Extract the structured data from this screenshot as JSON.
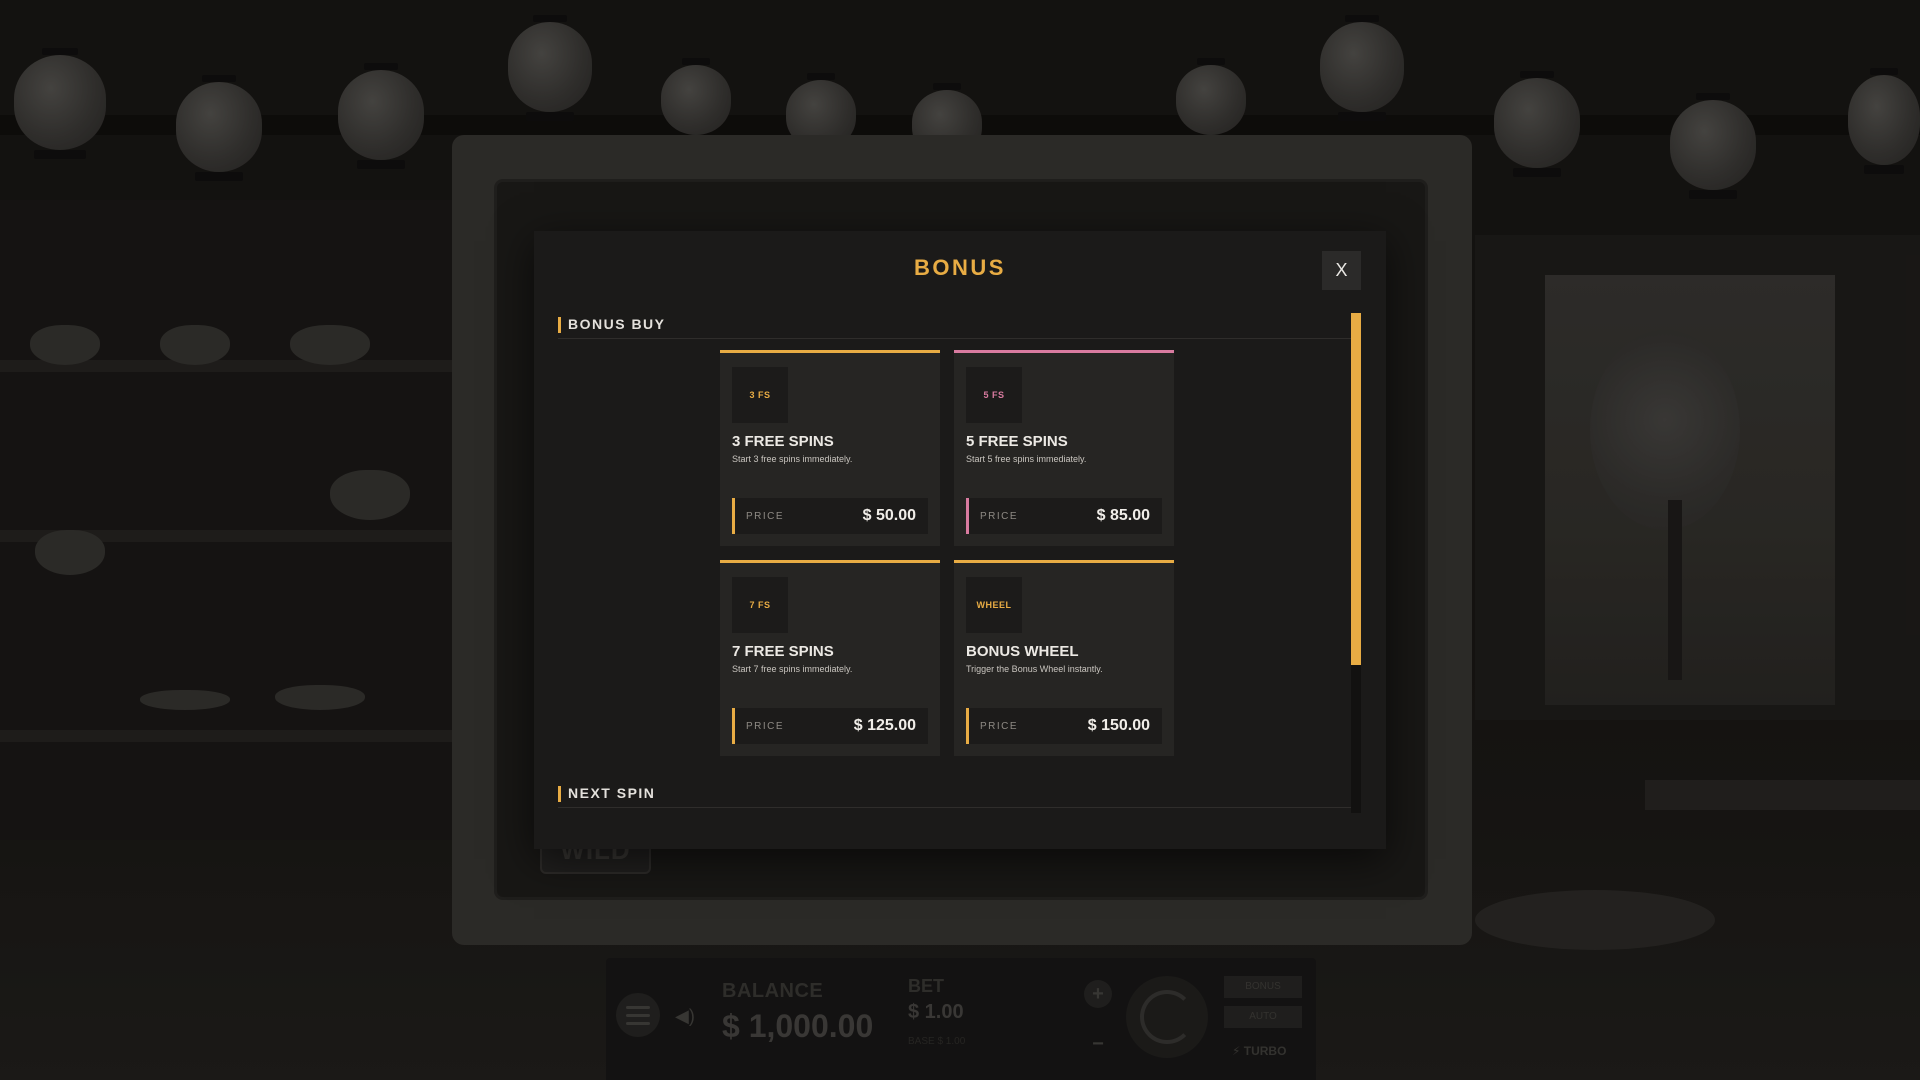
{
  "colors": {
    "accent": "#e8ac44",
    "accent_pink": "#d97ba0",
    "modal_bg": "#1b1a19",
    "card_bg": "#262523"
  },
  "modal": {
    "title": "BONUS",
    "close_label": "X",
    "sections": {
      "bonus_buy": "BONUS BUY",
      "next_spin": "NEXT SPIN"
    },
    "scroll_position": 0.0
  },
  "cards": [
    {
      "badge": "3 FS",
      "title": "3 FREE SPINS",
      "description": "Start 3 free spins immediately.",
      "price_label": "PRICE",
      "price": "$ 50.00",
      "accent": "#e8ac44"
    },
    {
      "badge": "5 FS",
      "title": "5 FREE SPINS",
      "description": "Start 5 free spins immediately.",
      "price_label": "PRICE",
      "price": "$ 85.00",
      "accent": "#d97ba0"
    },
    {
      "badge": "7 FS",
      "title": "7 FREE SPINS",
      "description": "Start 7 free spins immediately.",
      "price_label": "PRICE",
      "price": "$ 125.00",
      "accent": "#e8ac44"
    },
    {
      "badge": "WHEEL",
      "title": "BONUS WHEEL",
      "description": "Trigger the Bonus Wheel instantly.",
      "price_label": "PRICE",
      "price": "$ 150.00",
      "accent": "#e8ac44"
    }
  ],
  "background": {
    "wild_badge": "WILD"
  },
  "hud": {
    "balance_label": "BALANCE",
    "balance_value": "$ 1,000.00",
    "bet_label": "BET",
    "bet_value": "$ 1.00",
    "base_label": "BASE $ 1.00",
    "plus": "+",
    "minus": "−",
    "bonus_button": "BONUS",
    "auto_button": "AUTO",
    "turbo_label": "⚡ TURBO",
    "sound_icon": "speaker-icon",
    "menu_icon": "hamburger-icon"
  }
}
